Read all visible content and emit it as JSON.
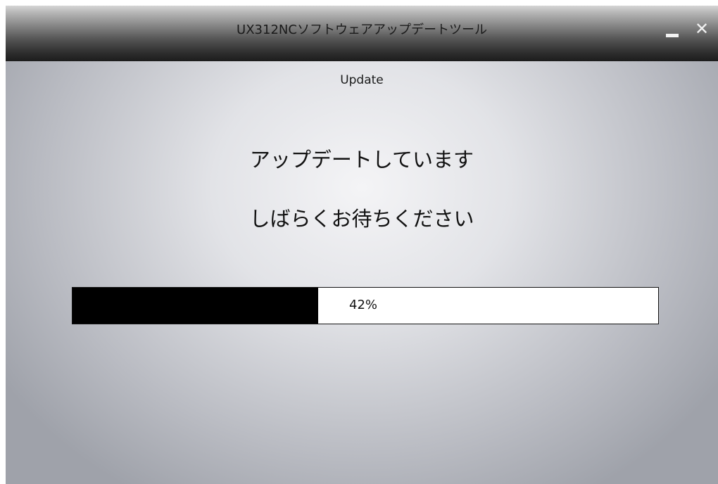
{
  "window": {
    "title": "UX312NCソフトウェアアップデートツール",
    "minimize_icon": "minimize-icon",
    "close_icon": "close-icon",
    "close_glyph": "✕"
  },
  "content": {
    "header": "Update",
    "message_line1": "アップデートしています",
    "message_line2": "しばらくお待ちください",
    "progress": {
      "value": 0.42,
      "label": "42%"
    }
  },
  "colors": {
    "progress_fill": "#000000",
    "progress_track": "#ffffff"
  }
}
